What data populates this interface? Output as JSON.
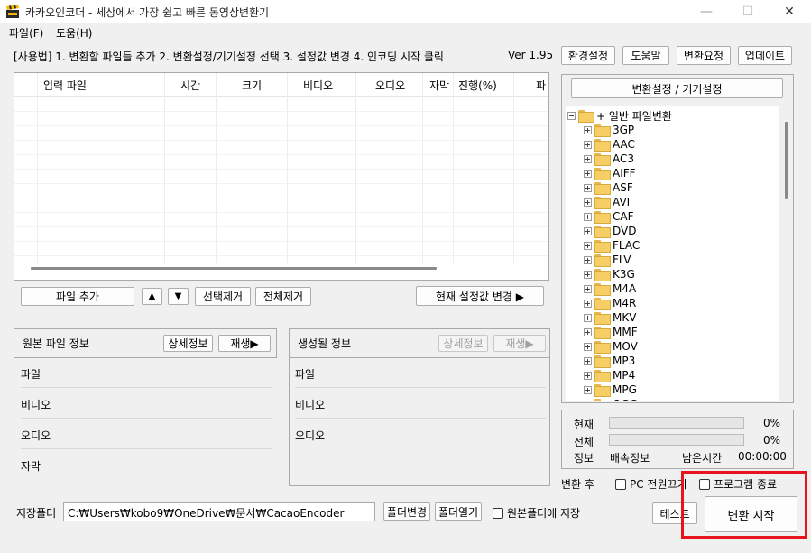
{
  "window": {
    "title": "카카오인코더 - 세상에서 가장 쉽고 빠른 동영상변환기",
    "minimize_glyph": "—",
    "maximize_glyph": "☐",
    "close_glyph": "✕"
  },
  "menu": {
    "items": [
      "파일(F)",
      "도움(H)"
    ]
  },
  "toolbar": {
    "usage_text": "[사용법] 1. 변환할 파일들 추가   2. 변환설정/기기설정 선택   3. 설정값 변경   4. 인코딩 시작 클릭",
    "version": "Ver 1.95",
    "buttons": [
      "환경설정",
      "도움말",
      "변환요청",
      "업데이트"
    ]
  },
  "file_list": {
    "columns": [
      "입력 파일",
      "시간",
      "크기",
      "비디오",
      "오디오",
      "자막",
      "진행(%)",
      "파"
    ],
    "rows": []
  },
  "file_actions": {
    "add_file": "파일 추가",
    "move_up": "▲",
    "move_down": "▼",
    "remove_selected": "선택제거",
    "remove_all": "전체제거",
    "change_current": "현재 설정값 변경 ▶"
  },
  "source_info": {
    "title": "원본 파일 정보",
    "detail_button": "상세정보",
    "play_button": "재생▶",
    "rows": [
      "파일",
      "비디오",
      "오디오",
      "자막"
    ]
  },
  "output_info": {
    "title": "생성될 정보",
    "detail_button": "상세정보",
    "play_button": "재생▶",
    "rows": [
      "파일",
      "비디오",
      "오디오"
    ]
  },
  "settings": {
    "header_button": "변환설정 / 기기설정",
    "tree_root": "+ 일반 파일변환",
    "formats": [
      "3GP",
      "AAC",
      "AC3",
      "AIFF",
      "ASF",
      "AVI",
      "CAF",
      "DVD",
      "FLAC",
      "FLV",
      "K3G",
      "M4A",
      "M4R",
      "MKV",
      "MMF",
      "MOV",
      "MP3",
      "MP4",
      "MPG",
      "OGG"
    ]
  },
  "progress": {
    "current_label": "현재",
    "current_value": 0,
    "current_pct": "0%",
    "total_label": "전체",
    "total_value": 0,
    "total_pct": "0%",
    "info_label": "정보",
    "speed_label": "배속정보",
    "remaining_label": "남은시간",
    "remaining_value": "00:00:00"
  },
  "after_convert": {
    "label": "변환 후",
    "pc_off": "PC 전원끄기",
    "quit_program": "프로그램 종료"
  },
  "save": {
    "label": "저장폴더",
    "path": "C:₩Users₩kobo9₩OneDrive₩문서₩CacaoEncoder",
    "change_folder": "폴더변경",
    "open_folder": "폴더열기",
    "save_in_source": "원본폴더에 저장",
    "test_button": "테스트",
    "start_button": "변환 시작"
  }
}
